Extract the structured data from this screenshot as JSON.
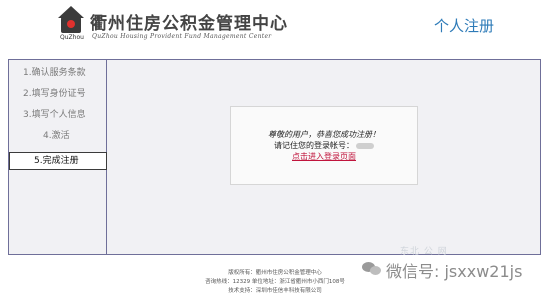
{
  "header": {
    "logo_label": "QuZhou",
    "site_title": "衢州住房公积金管理中心",
    "site_subtitle": "QuZhou Housing Provident Fund Management Center",
    "page_heading": "个人注册"
  },
  "sidebar": {
    "steps": [
      {
        "label": "1.确认服务条款"
      },
      {
        "label": "2.填写身份证号"
      },
      {
        "label": "3.填写个人信息"
      },
      {
        "label": "4.激活"
      },
      {
        "label": "5.完成注册"
      }
    ]
  },
  "message": {
    "congrats": "尊敬的用户，恭喜您成功注册！",
    "account_prefix": "请记住您的登录帐号：",
    "login_link": "点击进入登录页面"
  },
  "footer": {
    "line1": "版权所有：衢州市住房公积金管理中心",
    "line2": "咨询热线：12329      单位地址：浙江省衢州市小西门108号",
    "line3": "技术支持：深圳市佳信丰科技有限公司"
  },
  "watermark": {
    "faint": "东北  公  网",
    "text": "微信号: jsxxw21js"
  }
}
